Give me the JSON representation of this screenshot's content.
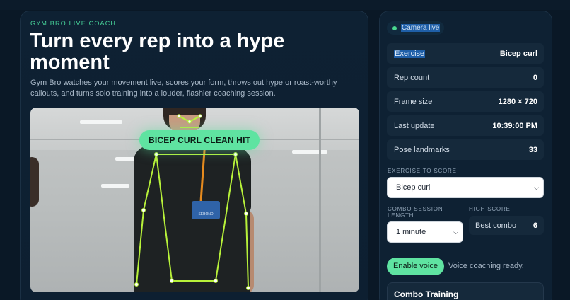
{
  "hero": {
    "eyebrow": "GYM BRO LIVE COACH",
    "title": "Turn every rep into a hype moment",
    "description": "Gym Bro watches your movement live, scores your form, throws out hype or roast-worthy callouts, and turns solo training into a louder, flashier coaching session."
  },
  "video": {
    "callout": "BICEP CURL CLEAN HIT",
    "badge_text": "SEBOND"
  },
  "panel": {
    "status": "Camera live",
    "stats": [
      {
        "label": "Exercise",
        "value": "Bicep curl"
      },
      {
        "label": "Rep count",
        "value": "0"
      },
      {
        "label": "Frame size",
        "value": "1280 × 720"
      },
      {
        "label": "Last update",
        "value": "10:39:00 PM"
      },
      {
        "label": "Pose landmarks",
        "value": "33"
      }
    ],
    "exercise_label": "EXERCISE TO SCORE",
    "exercise_value": "Bicep curl",
    "session_label": "COMBO SESSION LENGTH",
    "session_value": "1 minute",
    "high_score_label": "HIGH SCORE",
    "best_combo_label": "Best combo",
    "best_combo_value": "6",
    "voice_button": "Enable voice",
    "voice_status": "Voice coaching ready.",
    "combo_title": "Combo Training"
  },
  "colors": {
    "accent": "#5fe3a1",
    "background": "#0a1826",
    "card": "#0e2133",
    "skeleton": "#b8f23a"
  }
}
